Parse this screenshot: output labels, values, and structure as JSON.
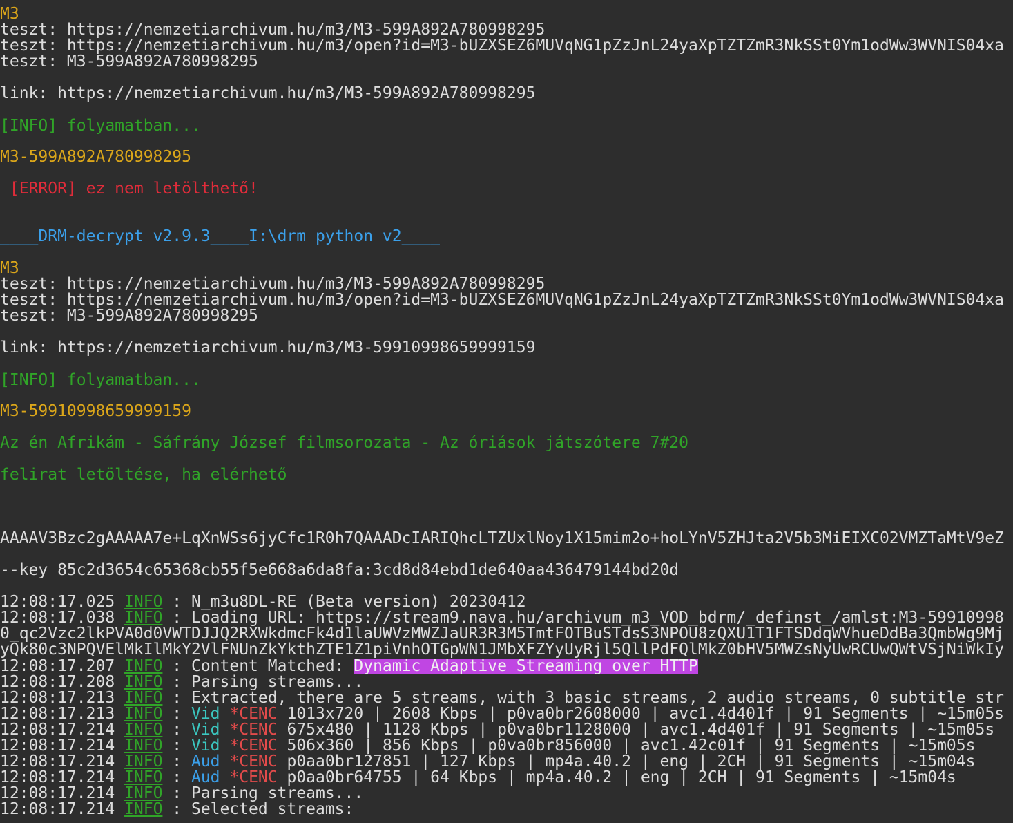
{
  "colors": {
    "background": "#2d2d2d",
    "yellow": "#dba61a",
    "green": "#30a428",
    "red": "#e02c3a",
    "blue": "#3ba0ea",
    "cyan": "#3bc7c0",
    "highlight": "#c046e3"
  },
  "block1": {
    "label": "M3",
    "teszt1": "teszt: https://nemzetiarchivum.hu/m3/M3-599A892A780998295",
    "teszt2": "teszt: https://nemzetiarchivum.hu/m3/open?id=M3-bUZXSEZ6MUVqNG1pZzJnL24yaXpTZTZmR3NkSSt0Ym1odWw3WVNIS04xa",
    "teszt3": "teszt: M3-599A892A780998295",
    "link": "link: https://nemzetiarchivum.hu/m3/M3-599A892A780998295",
    "info": "[INFO] folyamatban...",
    "id": "M3-599A892A780998295",
    "error": " [ERROR] ez nem letölthető!"
  },
  "banner": "____DRM-decrypt v2.9.3____I:\\drm python v2____",
  "block2": {
    "label": "M3",
    "teszt1": "teszt: https://nemzetiarchivum.hu/m3/M3-599A892A780998295",
    "teszt2": "teszt: https://nemzetiarchivum.hu/m3/open?id=M3-bUZXSEZ6MUVqNG1pZzJnL24yaXpTZTZmR3NkSSt0Ym1odWw3WVNIS04xa",
    "teszt3": "teszt: M3-599A892A780998295",
    "link": "link: https://nemzetiarchivum.hu/m3/M3-59910998659999159",
    "info": "[INFO] folyamatban...",
    "id": "M3-59910998659999159",
    "title": "Az én Afrikám - Sáfrány József filmsorozata - Az óriások játszótere 7#20",
    "subtitle_msg": "felirat letöltése, ha elérhető"
  },
  "pssh": "AAAAV3Bzc2gAAAAA7e+LqXnWSs6jyCfc1R0h7QAAADcIARIQhcLTZUxlNoy1X15mim2o+hoLYnV5ZHJta2V5b3MiEIXC02VMZTaMtV9eZ",
  "key": "--key 85c2d3654c65368cb55f5e668a6da8fa:3cd8d84ebd1de640aa436479144bd20d",
  "log": {
    "info_label": "INFO",
    "sep": " : ",
    "lines": [
      {
        "time": "12:08:17.025",
        "text": "N_m3u8DL-RE (Beta version) 20230412"
      },
      {
        "time": "12:08:17.038",
        "text": "Loading URL: https://stream9.nava.hu/archivum_m3_VOD_bdrm/_definst_/amlst:M3-59910998"
      },
      {
        "time": "12:08:17.207",
        "prefix": "Content Matched: ",
        "highlight": "Dynamic Adaptive Streaming over HTTP"
      },
      {
        "time": "12:08:17.208",
        "text": "Parsing streams..."
      },
      {
        "time": "12:08:17.213",
        "text": "Extracted, there are 5 streams, with 3 basic streams, 2 audio streams, 0 subtitle str"
      },
      {
        "time": "12:08:17.213",
        "kind": "Vid",
        "enc": "*CENC",
        "text": " 1013x720 | 2608 Kbps | p0va0br2608000 | avc1.4d401f | 91 Segments | ~15m05s"
      },
      {
        "time": "12:08:17.214",
        "kind": "Vid",
        "enc": "*CENC",
        "text": " 675x480 | 1128 Kbps | p0va0br1128000 | avc1.4d401f | 91 Segments | ~15m05s"
      },
      {
        "time": "12:08:17.214",
        "kind": "Vid",
        "enc": "*CENC",
        "text": " 506x360 | 856 Kbps | p0va0br856000 | avc1.42c01f | 91 Segments | ~15m05s"
      },
      {
        "time": "12:08:17.214",
        "kind": "Aud",
        "enc": "*CENC",
        "text": " p0aa0br127851 | 127 Kbps | mp4a.40.2 | eng | 2CH | 91 Segments | ~15m04s"
      },
      {
        "time": "12:08:17.214",
        "kind": "Aud",
        "enc": "*CENC",
        "text": " p0aa0br64755 | 64 Kbps | mp4a.40.2 | eng | 2CH | 91 Segments | ~15m04s"
      },
      {
        "time": "12:08:17.214",
        "text": "Parsing streams..."
      },
      {
        "time": "12:08:17.214",
        "text": "Selected streams:"
      }
    ],
    "wrap1": "0_qc2Vzc2lkPVA0d0VWTDJJQ2RXWkdmcFk4d1laUWVzMWZJaUR3R3M5TmtFOTBuSTdsS3NPOU8zQXU1T1FTSDdqWVhueDdBa3QmbWg9Mj",
    "wrap2": "yQk80c3NPQVElMkIlMkY2VlFNUnZkYkthZTE1Z1piVnhOTGpWN1JMbXFZYyUyRjl5QllPdFQlMkZ0bHV5MWZsNyUwRCUwQWtVSjNiWkIy"
  }
}
